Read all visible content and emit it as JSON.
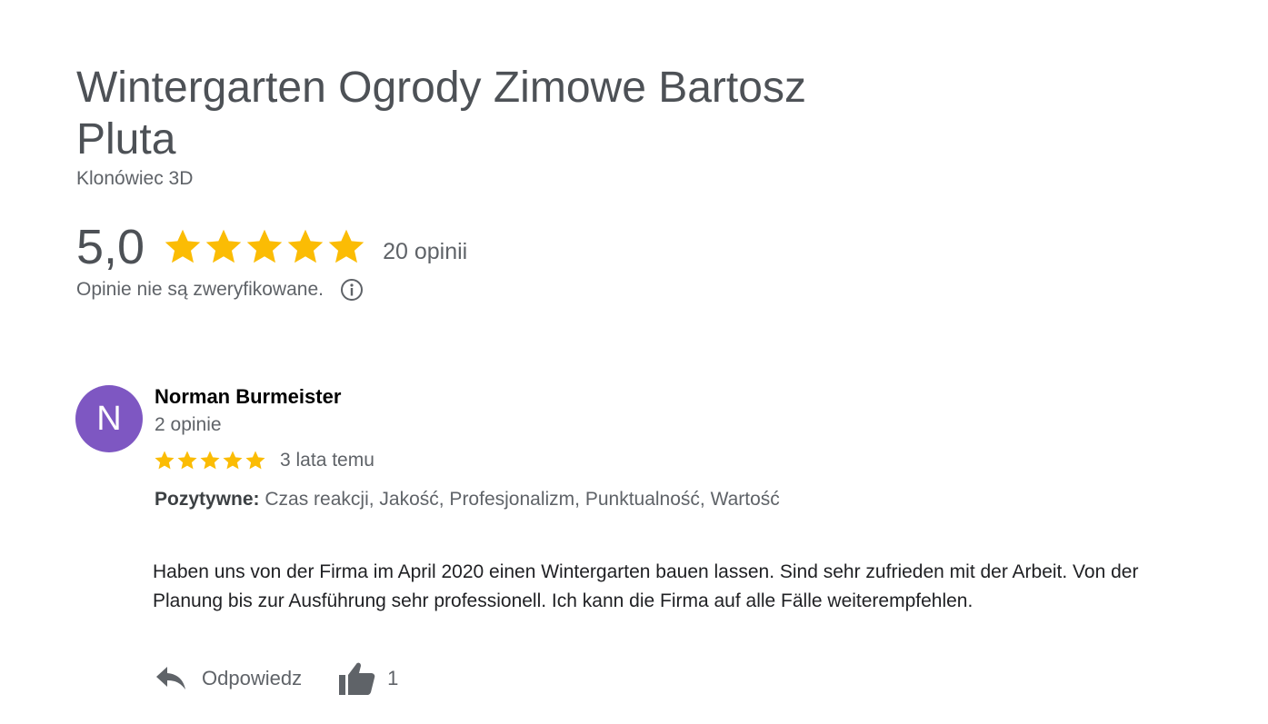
{
  "business": {
    "name": "Wintergarten Ogrody Zimowe Bartosz Pluta",
    "location": "Klonówiec 3D"
  },
  "rating": {
    "score": "5,0",
    "stars": 5,
    "count_label": "20 opinii",
    "unverified_note": "Opinie nie są zweryfikowane.",
    "star_color": "#fbbc04"
  },
  "review": {
    "avatar_initial": "N",
    "avatar_color": "#7e57c2",
    "reviewer_name": "Norman Burmeister",
    "reviewer_reviews": "2 opinie",
    "stars": 5,
    "time": "3 lata temu",
    "attributes_label": "Pozytywne:",
    "attributes_values": "Czas reakcji, Jakość, Profesjonalizm, Punktualność, Wartość",
    "text": "Haben uns von der Firma im April 2020 einen Wintergarten bauen lassen. Sind sehr zufrieden mit der Arbeit. Von der Planung bis zur Ausführung sehr professionell. Ich kann die Firma auf alle Fälle weiterempfehlen.",
    "reply_label": "Odpowiedz",
    "like_count": "1"
  },
  "icons": {
    "info": "info-icon",
    "reply": "reply-arrow-icon",
    "like": "thumbs-up-icon",
    "star": "star-icon"
  }
}
